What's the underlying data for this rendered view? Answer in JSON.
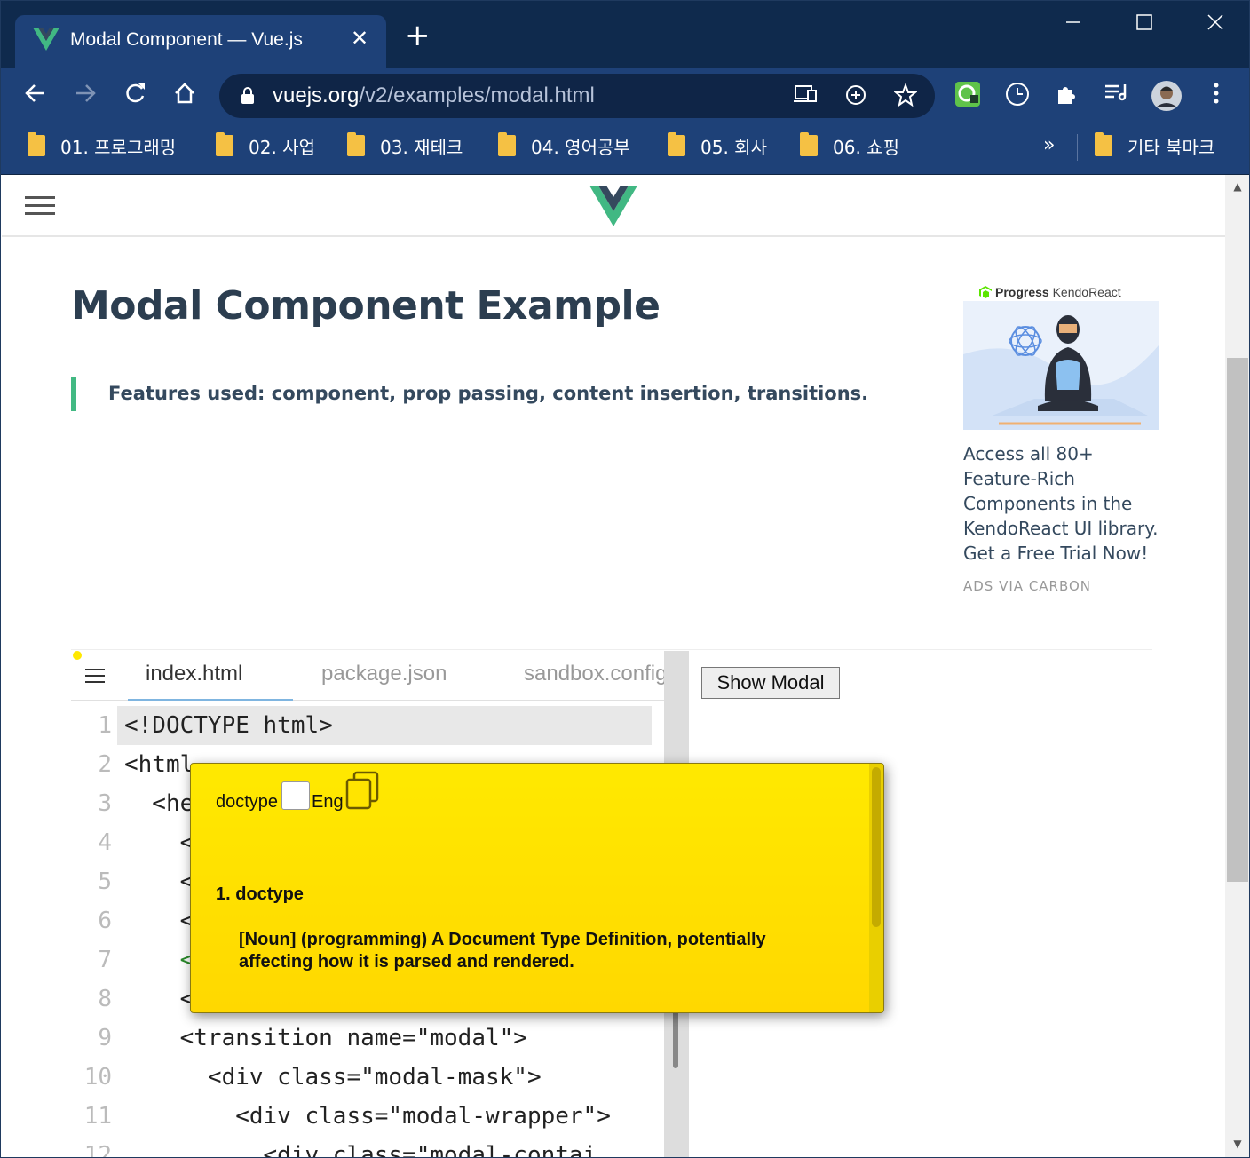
{
  "browser": {
    "tab_title": "Modal Component — Vue.js",
    "tab_close": "✕",
    "new_tab": "+",
    "url_host": "vuejs.org",
    "url_path": "/v2/examples/modal.html",
    "window_controls": {
      "minimize": "—",
      "maximize": "☐",
      "close": "✕"
    },
    "bookmarks": [
      {
        "label": "01. 프로그래밍"
      },
      {
        "label": "02. 사업"
      },
      {
        "label": "03. 재테크"
      },
      {
        "label": "04. 영어공부"
      },
      {
        "label": "05. 회사"
      },
      {
        "label": "06. 쇼핑"
      }
    ],
    "bookmarks_more": "»",
    "other_bookmarks": "기타 북마크"
  },
  "page": {
    "title": "Modal Component Example",
    "tip": "Features used: component, prop passing, content insertion, transitions.",
    "ad": {
      "brand_progress": "Progress",
      "brand_product": "KendoReact",
      "text": "Access all 80+ Feature-Rich Components in the KendoReact UI library. Get a Free Trial Now!",
      "via": "ADS VIA CARBON"
    },
    "editor": {
      "tabs": [
        "index.html",
        "package.json",
        "sandbox.config"
      ],
      "lines": [
        {
          "n": "1",
          "code": "<!DOCTYPE html>"
        },
        {
          "n": "2",
          "code": "<html"
        },
        {
          "n": "3",
          "code": "  <he"
        },
        {
          "n": "4",
          "code": "    <"
        },
        {
          "n": "5",
          "code": "    <"
        },
        {
          "n": "6",
          "code": "    <"
        },
        {
          "n": "7",
          "code": "    <"
        },
        {
          "n": "8",
          "code": "    <"
        },
        {
          "n": "9",
          "code": "    <transition name=\"modal\">"
        },
        {
          "n": "10",
          "code": "      <div class=\"modal-mask\">"
        },
        {
          "n": "11",
          "code": "        <div class=\"modal-wrapper\">"
        },
        {
          "n": "12",
          "code": "          <div class=\"modal-contai"
        }
      ]
    },
    "show_modal_button": "Show Modal"
  },
  "dictionary_popup": {
    "word": "doctype",
    "lang": "Eng",
    "entry_number": "1.",
    "entry_word": "doctype",
    "definition": "[Noun] (programming) A Document Type Definition, potentially affecting how it is parsed and rendered."
  }
}
